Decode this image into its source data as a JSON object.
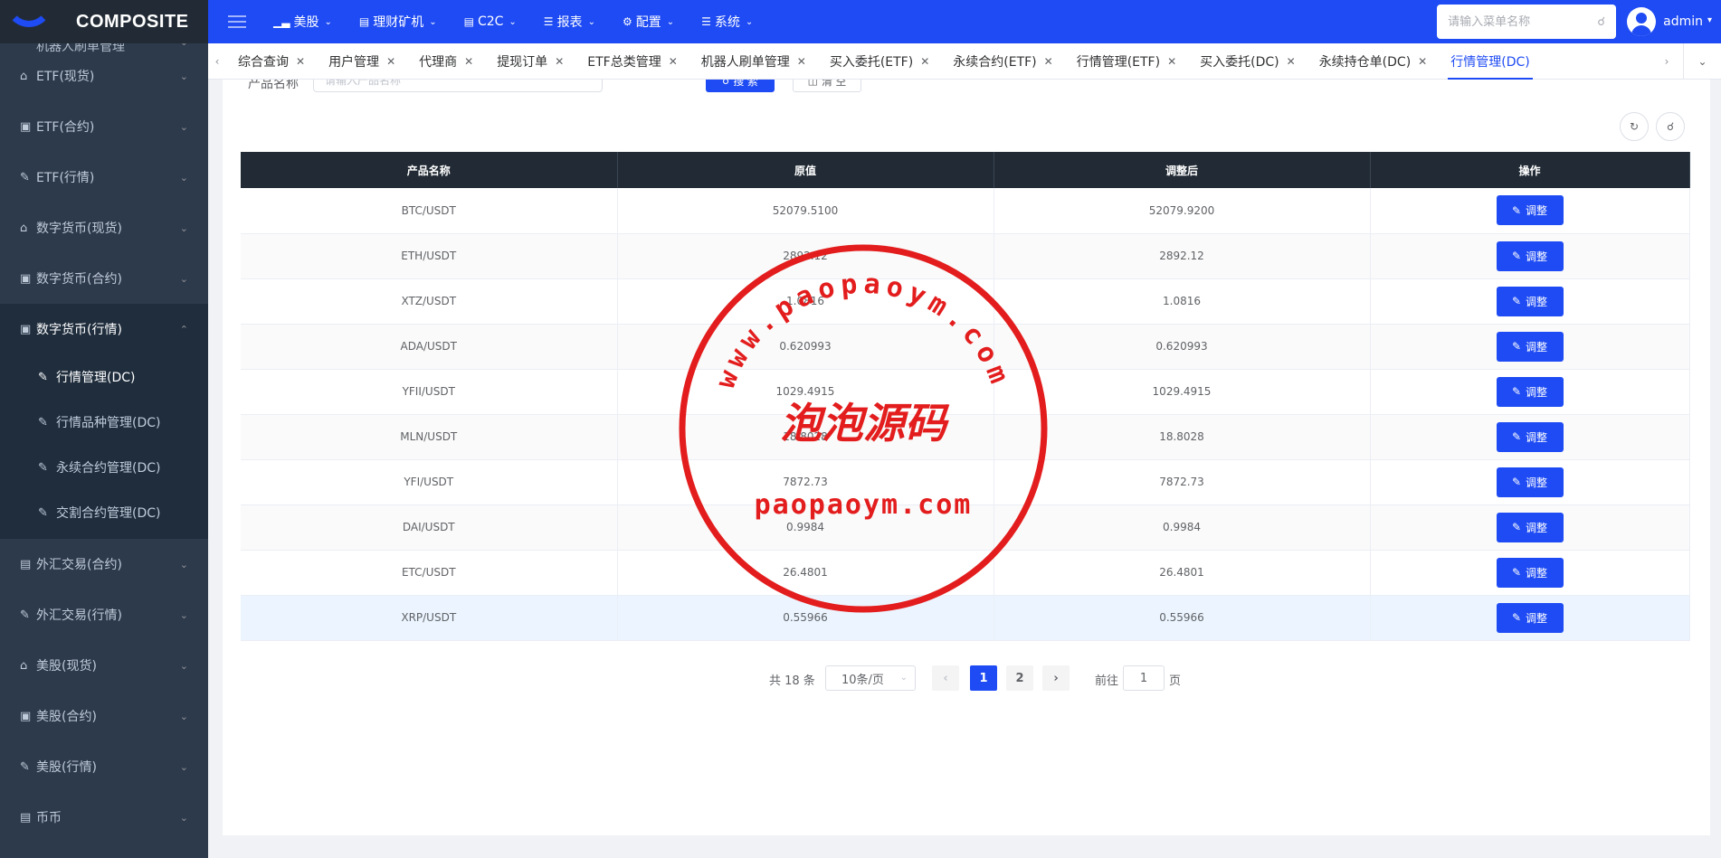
{
  "app": {
    "logo": "COMPOSITE"
  },
  "topnav": {
    "items": [
      {
        "label": "美股",
        "icon": "chart-icon"
      },
      {
        "label": "理财矿机",
        "icon": "doc-icon"
      },
      {
        "label": "C2C",
        "icon": "doc-icon"
      },
      {
        "label": "报表",
        "icon": "list-icon"
      },
      {
        "label": "配置",
        "icon": "gear-icon"
      },
      {
        "label": "系统",
        "icon": "list-icon"
      }
    ],
    "search_placeholder": "请输入菜单名称",
    "username": "admin"
  },
  "sidebar": {
    "top_partial": "机器人刷单管理",
    "items_before": [
      {
        "label": "ETF(现货)",
        "icon": "shop-icon"
      },
      {
        "label": "ETF(合约)",
        "icon": "contract-icon"
      },
      {
        "label": "ETF(行情)",
        "icon": "edit-icon"
      },
      {
        "label": "数字货币(现货)",
        "icon": "shop-icon"
      },
      {
        "label": "数字货币(合约)",
        "icon": "contract-icon"
      }
    ],
    "active_group": {
      "label": "数字货币(行情)",
      "icon": "contract-icon",
      "children": [
        {
          "label": "行情管理(DC)"
        },
        {
          "label": "行情品种管理(DC)"
        },
        {
          "label": "永续合约管理(DC)"
        },
        {
          "label": "交割合约管理(DC)"
        }
      ]
    },
    "items_after": [
      {
        "label": "外汇交易(合约)",
        "icon": "doc-icon"
      },
      {
        "label": "外汇交易(行情)",
        "icon": "edit-icon"
      },
      {
        "label": "美股(现货)",
        "icon": "shop-icon"
      },
      {
        "label": "美股(合约)",
        "icon": "contract-icon"
      },
      {
        "label": "美股(行情)",
        "icon": "edit-icon"
      },
      {
        "label": "币币",
        "icon": "doc-icon"
      }
    ]
  },
  "tabs": [
    {
      "label": "综合查询",
      "active": false
    },
    {
      "label": "用户管理",
      "active": false
    },
    {
      "label": "代理商",
      "active": false
    },
    {
      "label": "提现订单",
      "active": false
    },
    {
      "label": "ETF总类管理",
      "active": false
    },
    {
      "label": "机器人刷单管理",
      "active": false
    },
    {
      "label": "买入委托(ETF)",
      "active": false
    },
    {
      "label": "永续合约(ETF)",
      "active": false
    },
    {
      "label": "行情管理(ETF)",
      "active": false
    },
    {
      "label": "买入委托(DC)",
      "active": false
    },
    {
      "label": "永续持仓单(DC)",
      "active": false
    },
    {
      "label": "行情管理(DC)",
      "active": true
    }
  ],
  "search": {
    "label": "产品名称",
    "placeholder": "请输入产品名称",
    "search_btn": "搜 索",
    "clear_btn": "清 空"
  },
  "table": {
    "headers": [
      "产品名称",
      "原值",
      "调整后",
      "操作"
    ],
    "action_label": "调整",
    "rows": [
      {
        "name": "BTC/USDT",
        "orig": "52079.5100",
        "adj": "52079.9200"
      },
      {
        "name": "ETH/USDT",
        "orig": "2892.12",
        "adj": "2892.12"
      },
      {
        "name": "XTZ/USDT",
        "orig": "1.0816",
        "adj": "1.0816"
      },
      {
        "name": "ADA/USDT",
        "orig": "0.620993",
        "adj": "0.620993"
      },
      {
        "name": "YFII/USDT",
        "orig": "1029.4915",
        "adj": "1029.4915"
      },
      {
        "name": "MLN/USDT",
        "orig": "18.8028",
        "adj": "18.8028"
      },
      {
        "name": "YFI/USDT",
        "orig": "7872.73",
        "adj": "7872.73"
      },
      {
        "name": "DAI/USDT",
        "orig": "0.9984",
        "adj": "0.9984"
      },
      {
        "name": "ETC/USDT",
        "orig": "26.4801",
        "adj": "26.4801"
      },
      {
        "name": "XRP/USDT",
        "orig": "0.55966",
        "adj": "0.55966"
      }
    ]
  },
  "pagination": {
    "total": "共 18 条",
    "page_size": "10条/页",
    "pages": [
      "1",
      "2"
    ],
    "current": "1",
    "goto_label": "前往",
    "goto_value": "1",
    "page_suffix": "页"
  },
  "watermark": {
    "url_top": "www.paopaoym.com",
    "cn": "泡泡源码",
    "url_bottom": "paopaoym.com"
  },
  "colors": {
    "primary": "#1e4bf3",
    "sidebar": "#2d3a4b",
    "header_dark": "#222b35",
    "stamp": "#e31d1d"
  }
}
